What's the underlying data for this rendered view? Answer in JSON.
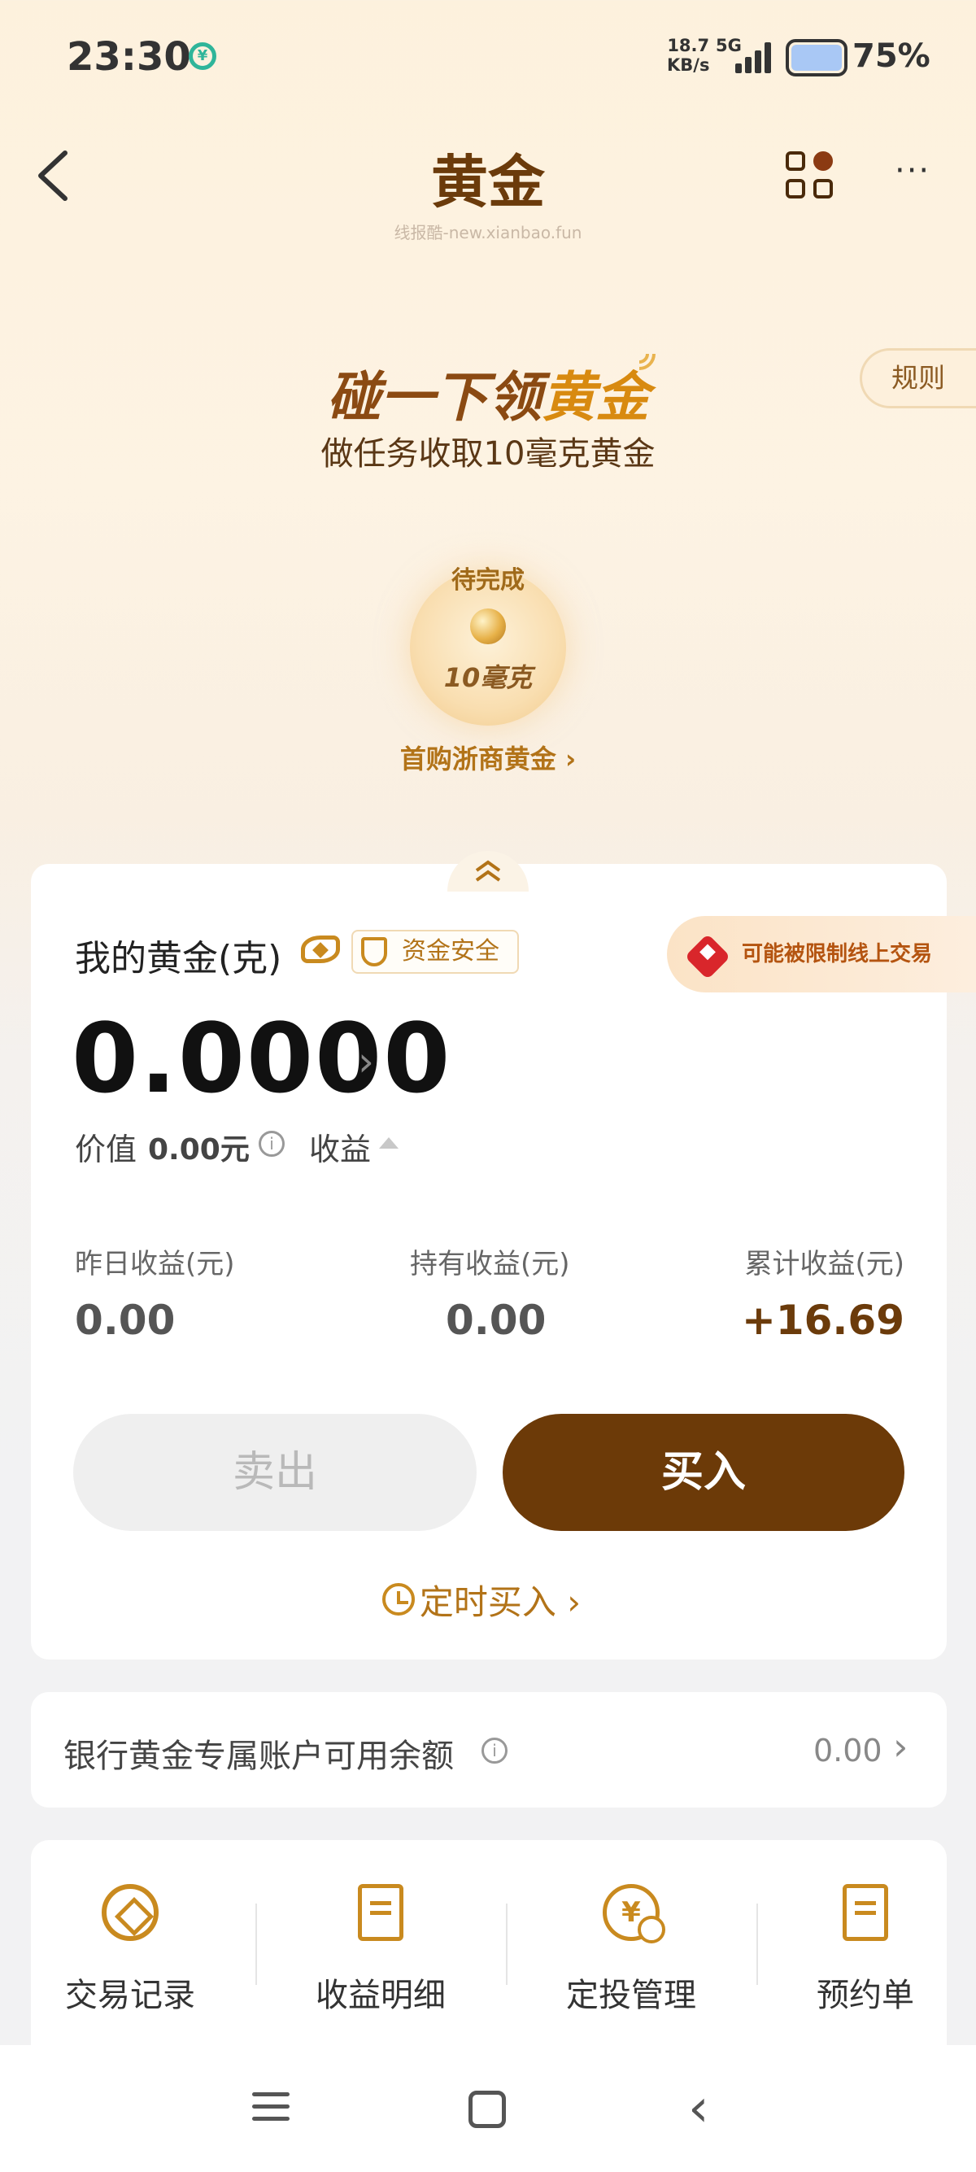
{
  "status_bar": {
    "time": "23:30",
    "net_speed_value": "18.7",
    "net_speed_unit": "KB/s",
    "network": "5G",
    "battery": "75%"
  },
  "header": {
    "title": "黄金",
    "watermark": "线报酷-new.xianbao.fun"
  },
  "banner": {
    "title_prefix": "碰一下领",
    "title_highlight": "黄金",
    "subtitle": "做任务收取10毫克黄金",
    "rules_label": "规则",
    "task_status": "待完成",
    "reward_amount": "10毫克",
    "task_link": "首购浙商黄金 ›"
  },
  "holdings": {
    "label": "我的黄金(克)",
    "safe_badge": "资金安全",
    "limit_notice": "可能被限制线上交易",
    "amount": "0.0000",
    "value_label": "价值",
    "value_amount": "0.00元",
    "profit_label": "收益",
    "stats": {
      "yesterday_label": "昨日收益(元)",
      "yesterday_value": "0.00",
      "holding_label": "持有收益(元)",
      "holding_value": "0.00",
      "cumulative_label": "累计收益(元)",
      "cumulative_value": "+16.69"
    },
    "sell_label": "卖出",
    "buy_label": "买入",
    "timed_buy_label": "定时买入 ›"
  },
  "balance": {
    "label": "银行黄金专属账户可用余额",
    "value": "0.00"
  },
  "shortcuts": [
    {
      "label": "交易记录",
      "icon": "record-icon"
    },
    {
      "label": "收益明细",
      "icon": "detail-icon"
    },
    {
      "label": "定投管理",
      "icon": "fixed-investment-icon"
    },
    {
      "label": "预约单",
      "icon": "order-icon"
    }
  ],
  "colors": {
    "brand_brown": "#6c3a08",
    "gold_accent": "#c98a1f",
    "limit_red": "#d9262b"
  }
}
